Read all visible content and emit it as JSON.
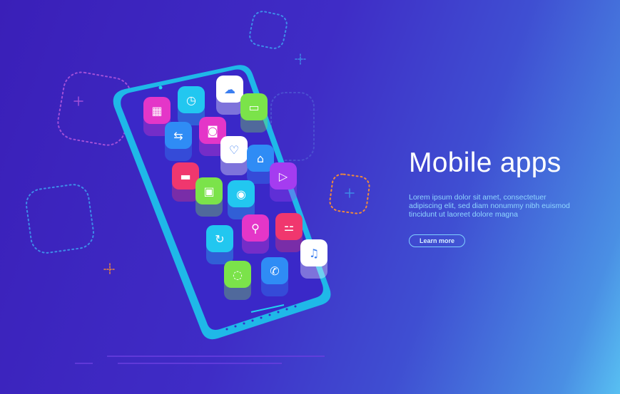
{
  "hero": {
    "title": "Mobile apps",
    "description": "Lorem ipsum dolor sit amet, consectetuer adipiscing elit, sed diam nonummy nibh euismod tincidunt ut laoreet dolore magna",
    "button_label": "Learn more"
  },
  "colors": {
    "phone_frame": "#22d3f0",
    "accent": "#7fd0ff",
    "magenta": "#e436c8",
    "cyan": "#22c7f0",
    "green": "#7be34a",
    "white": "#ffffff",
    "blue": "#2f8cf5",
    "red": "#f0376e",
    "purple": "#a53cf0"
  },
  "apps": [
    {
      "icon": "calendar-icon",
      "color": "magenta"
    },
    {
      "icon": "clock-icon",
      "color": "cyan"
    },
    {
      "icon": "cloud-icon",
      "color": "white"
    },
    {
      "icon": "chat-icon",
      "color": "green"
    },
    {
      "icon": "arrows-icon",
      "color": "blue"
    },
    {
      "icon": "camera-icon",
      "color": "magenta"
    },
    {
      "icon": "heart-icon",
      "color": "white"
    },
    {
      "icon": "home-icon",
      "color": "blue"
    },
    {
      "icon": "credit-card-icon",
      "color": "red"
    },
    {
      "icon": "wallet-icon",
      "color": "green"
    },
    {
      "icon": "user-icon",
      "color": "cyan"
    },
    {
      "icon": "play-icon",
      "color": "purple"
    },
    {
      "icon": "refresh-icon",
      "color": "cyan"
    },
    {
      "icon": "location-pin-icon",
      "color": "magenta"
    },
    {
      "icon": "dumbbell-icon",
      "color": "red"
    },
    {
      "icon": "music-icon",
      "color": "white"
    },
    {
      "icon": "message-icon",
      "color": "green"
    },
    {
      "icon": "phone-call-icon",
      "color": "blue"
    }
  ]
}
